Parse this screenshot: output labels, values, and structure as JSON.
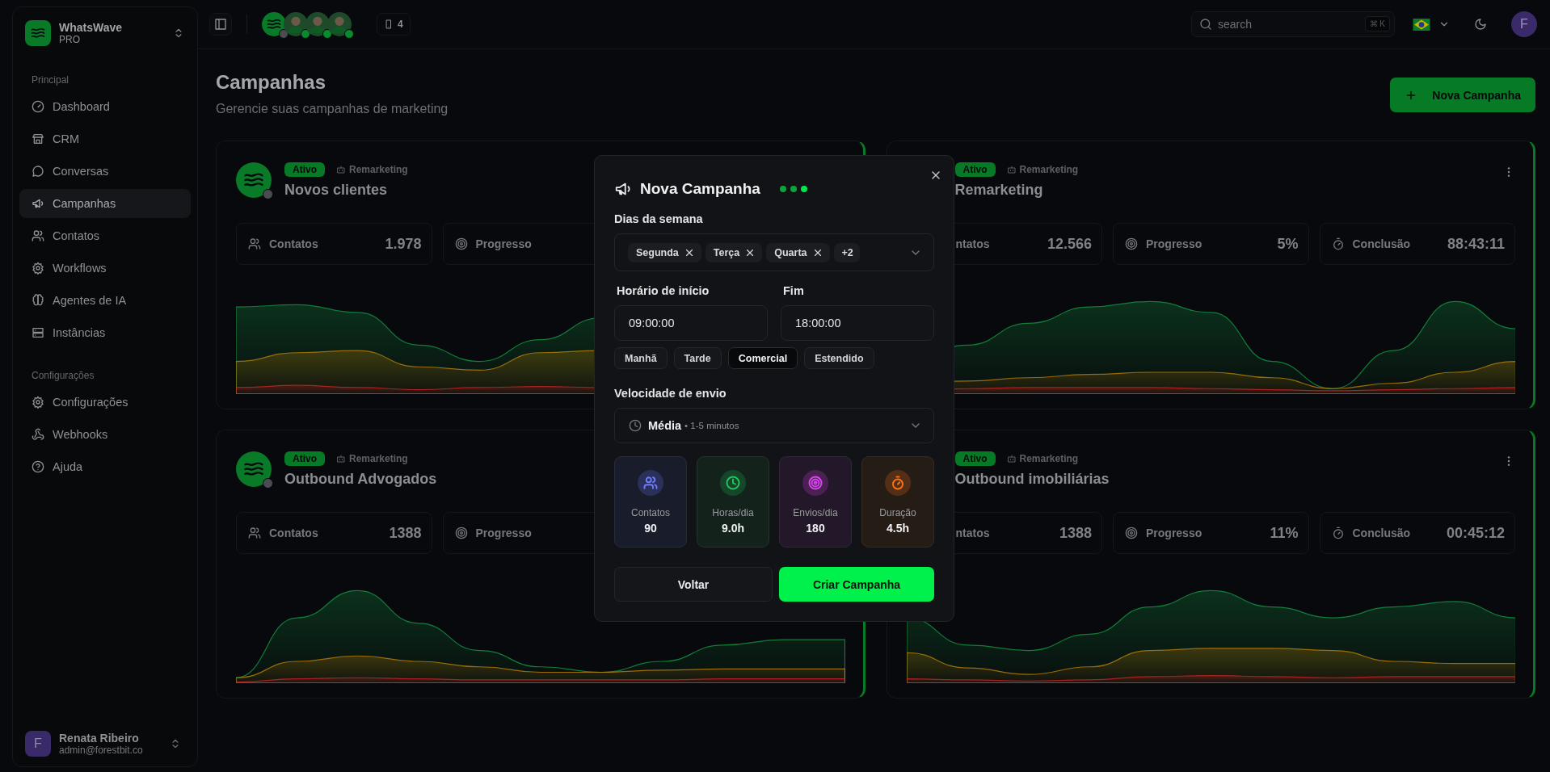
{
  "sidebar": {
    "brand": {
      "name": "WhatsWave",
      "plan": "PRO"
    },
    "sections": [
      {
        "title": "Principal",
        "items": [
          {
            "label": "Dashboard",
            "selected": false
          },
          {
            "label": "CRM",
            "selected": false
          },
          {
            "label": "Conversas",
            "selected": false
          },
          {
            "label": "Campanhas",
            "selected": true
          },
          {
            "label": "Contatos",
            "selected": false
          },
          {
            "label": "Workflows",
            "selected": false
          },
          {
            "label": "Agentes de IA",
            "selected": false
          },
          {
            "label": "Instâncias",
            "selected": false
          }
        ]
      },
      {
        "title": "Configurações",
        "items": [
          {
            "label": "Configurações",
            "selected": false
          },
          {
            "label": "Webhooks",
            "selected": false
          },
          {
            "label": "Ajuda",
            "selected": false
          }
        ]
      }
    ],
    "user": {
      "initial": "F",
      "name": "Renata Ribeiro",
      "email": "admin@forestbit.co"
    }
  },
  "topbar": {
    "instances": [
      {
        "kind": "logo",
        "online": false
      },
      {
        "kind": "person",
        "online": true
      },
      {
        "kind": "person",
        "online": true
      },
      {
        "kind": "person",
        "online": true
      }
    ],
    "device_count": "4",
    "search": {
      "placeholder": "search",
      "shortcut": "⌘ K"
    },
    "avatar_initial": "F"
  },
  "page": {
    "title": "Campanhas",
    "subtitle": "Gerencie suas campanhas de marketing",
    "new_button": "Nova Campanha"
  },
  "campaigns": [
    {
      "status": "Ativo",
      "type": "Remarketing",
      "name": "Novos clientes",
      "online": false,
      "stats": [
        {
          "kind": "contacts",
          "label": "Contatos",
          "value": "1.978"
        },
        {
          "kind": "progress",
          "label": "Progresso"
        }
      ]
    },
    {
      "status": "Ativo",
      "type": "Remarketing",
      "name": "Remarketing",
      "stats": [
        {
          "kind": "cut",
          "label": "ntatos",
          "value": "12.566"
        },
        {
          "kind": "progress",
          "label": "Progresso",
          "value": "5%"
        },
        {
          "kind": "eta",
          "label": "Conclusão",
          "value": "88:43:11"
        }
      ]
    },
    {
      "status": "Ativo",
      "type": "Remarketing",
      "name": "Outbound Advogados",
      "online": false,
      "stats": [
        {
          "kind": "contacts",
          "label": "Contatos",
          "value": "1388"
        },
        {
          "kind": "progress",
          "label": "Progresso"
        }
      ]
    },
    {
      "status": "Ativo",
      "type": "Remarketing",
      "name": "Outbound imobiliárias",
      "stats": [
        {
          "kind": "cut",
          "label": "ntatos",
          "value": "1388"
        },
        {
          "kind": "progress",
          "label": "Progresso",
          "value": "11%"
        },
        {
          "kind": "eta",
          "label": "Conclusão",
          "value": "00:45:12"
        }
      ]
    }
  ],
  "modal": {
    "title": "Nova Campanha",
    "steps": [
      {
        "selected": false
      },
      {
        "selected": false
      },
      {
        "selected": true
      }
    ],
    "days_label": "Dias da semana",
    "days": [
      "Segunda",
      "Terça",
      "Quarta"
    ],
    "days_more": "+2",
    "start_label": "Horário de início",
    "start_value": "09:00:00",
    "end_label": "Fim",
    "end_value": "18:00:00",
    "presets": [
      {
        "label": "Manhã",
        "selected": false
      },
      {
        "label": "Tarde",
        "selected": false
      },
      {
        "label": "Comercial",
        "selected": true
      },
      {
        "label": "Estendido",
        "selected": false
      }
    ],
    "speed_label": "Velocidade de envio",
    "speed": {
      "name": "Média",
      "detail": "• 1-5 minutos"
    },
    "summary": [
      {
        "label": "Contatos",
        "value": "90",
        "color": "#6b7cff"
      },
      {
        "label": "Horas/dia",
        "value": "9.0h",
        "color": "#22c55e"
      },
      {
        "label": "Envios/dia",
        "value": "180",
        "color": "#d946ef"
      },
      {
        "label": "Duração",
        "value": "4.5h",
        "color": "#f97316"
      }
    ],
    "back": "Voltar",
    "create": "Criar Campanha"
  }
}
